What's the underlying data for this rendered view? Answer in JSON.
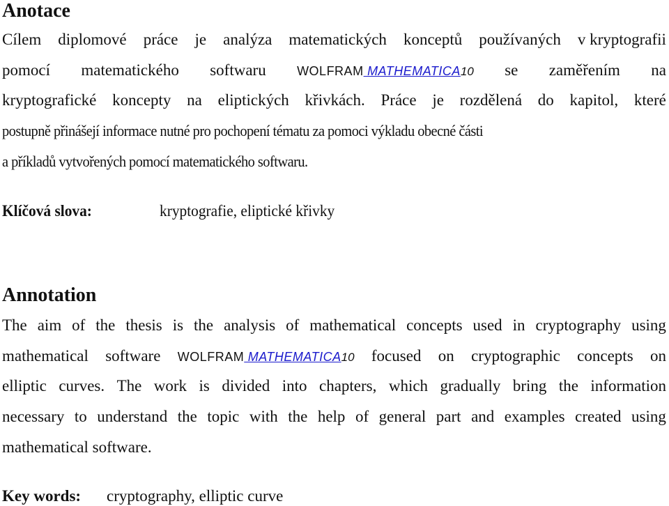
{
  "czech": {
    "heading": "Anotace",
    "lines": [
      [
        "Cílem",
        "diplomové",
        "práce",
        "je",
        "analýza",
        "matematických",
        "konceptů",
        "používaných",
        "v kryptografii"
      ],
      [
        "pomocí",
        "matematického",
        "softwaru"
      ],
      [
        "kryptografické",
        "koncepty",
        "na",
        "eliptických",
        "křivkách.",
        "Práce",
        "je",
        "rozdělená",
        "do",
        "kapitol,",
        "které"
      ],
      "postupně přinášejí informace nutné pro pochopení tématu za pomoci výkladu obecné části",
      "a příkladů vytvořených pomocí matematického softwaru."
    ],
    "line2_tail": [
      "se",
      "zaměřením",
      "na"
    ],
    "keywords_label": "Klíčová slova:",
    "keywords_value": "kryptografie, eliptické křivky"
  },
  "software": {
    "brand": "WOLFRAM",
    "link_text": " MATHEMATICA",
    "version": "10",
    "link_color": "#1a1acc"
  },
  "english": {
    "heading": "Annotation",
    "lines": [
      [
        "The",
        "aim",
        "of",
        "the",
        "thesis",
        "is",
        "the",
        "analysis",
        "of",
        "mathematical",
        "concepts",
        "used",
        "in",
        "cryptography",
        "using"
      ],
      [
        "mathematical",
        "software"
      ],
      [
        "elliptic",
        "curves.",
        "The",
        "work",
        "is",
        "divided",
        "into",
        "chapters,",
        "which",
        "gradually",
        "bring",
        "the",
        "information"
      ],
      [
        "necessary",
        "to",
        "understand",
        "the",
        "topic",
        "with",
        "the",
        "help",
        "of",
        "general",
        "part",
        "and",
        "examples",
        "created",
        "using"
      ],
      "mathematical software."
    ],
    "line2_tail": [
      "focused",
      "on",
      "cryptographic",
      "concepts",
      "on"
    ],
    "keywords_label": "Key words:",
    "keywords_value": "cryptography, elliptic curve"
  }
}
